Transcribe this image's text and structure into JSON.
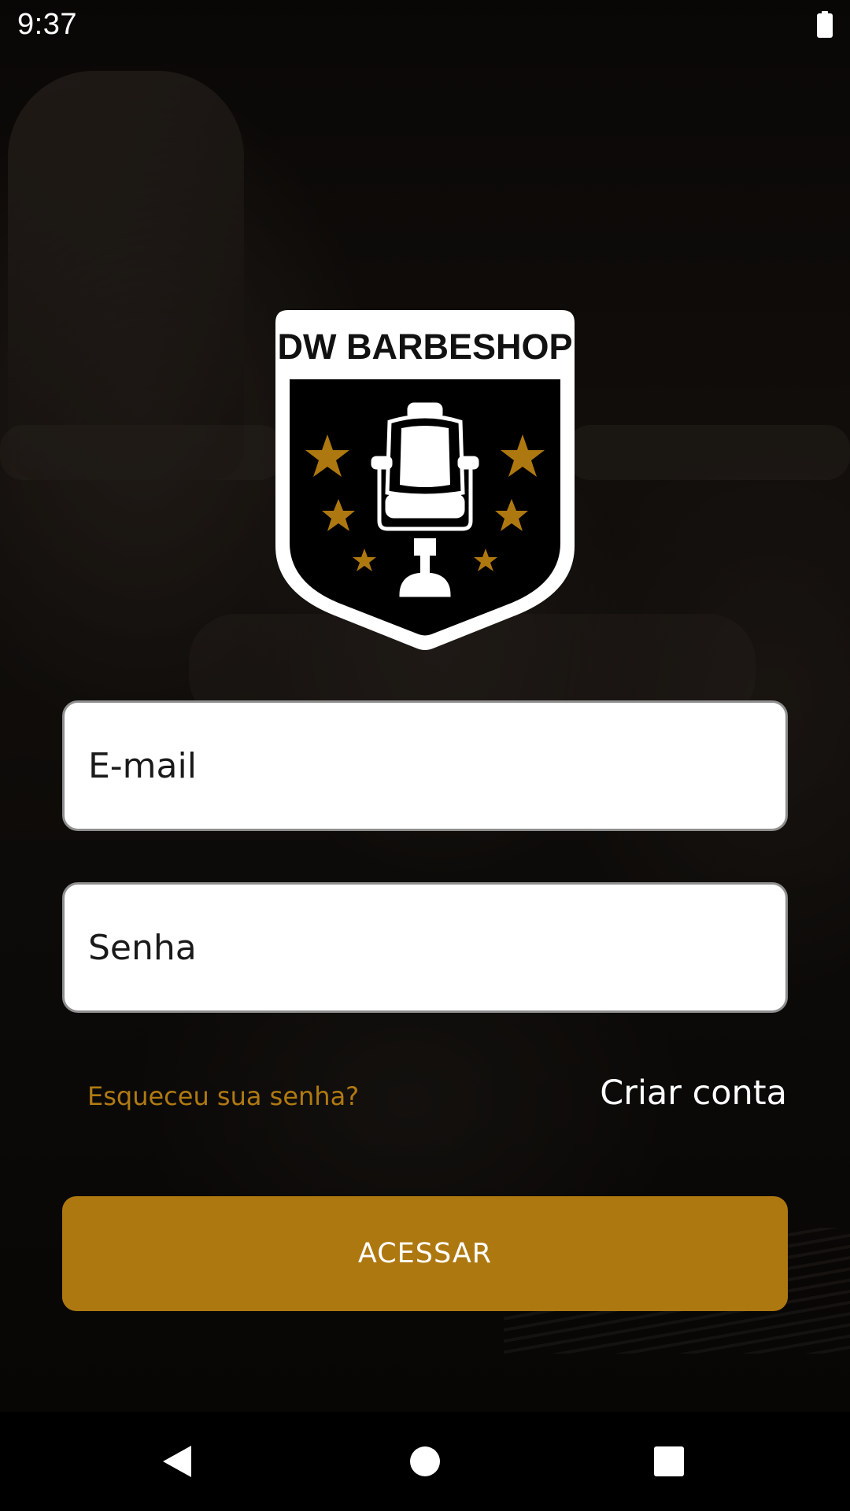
{
  "status_bar": {
    "time": "9:37",
    "battery_icon": "battery-full-icon"
  },
  "logo": {
    "brand_text": "DW BARBESHOP",
    "icon": "barber-chair-icon",
    "star_color": "#ae7810"
  },
  "login_form": {
    "email_placeholder": "E-mail",
    "password_placeholder": "Senha",
    "forgot_password_label": "Esqueceu sua senha?",
    "create_account_label": "Criar conta",
    "submit_label": "ACESSAR"
  },
  "colors": {
    "accent": "#ae7810",
    "input_background": "#ffffff",
    "text_light": "#ffffff"
  },
  "nav_bar": {
    "back_icon": "back-triangle-icon",
    "home_icon": "home-circle-icon",
    "recents_icon": "recents-square-icon"
  }
}
